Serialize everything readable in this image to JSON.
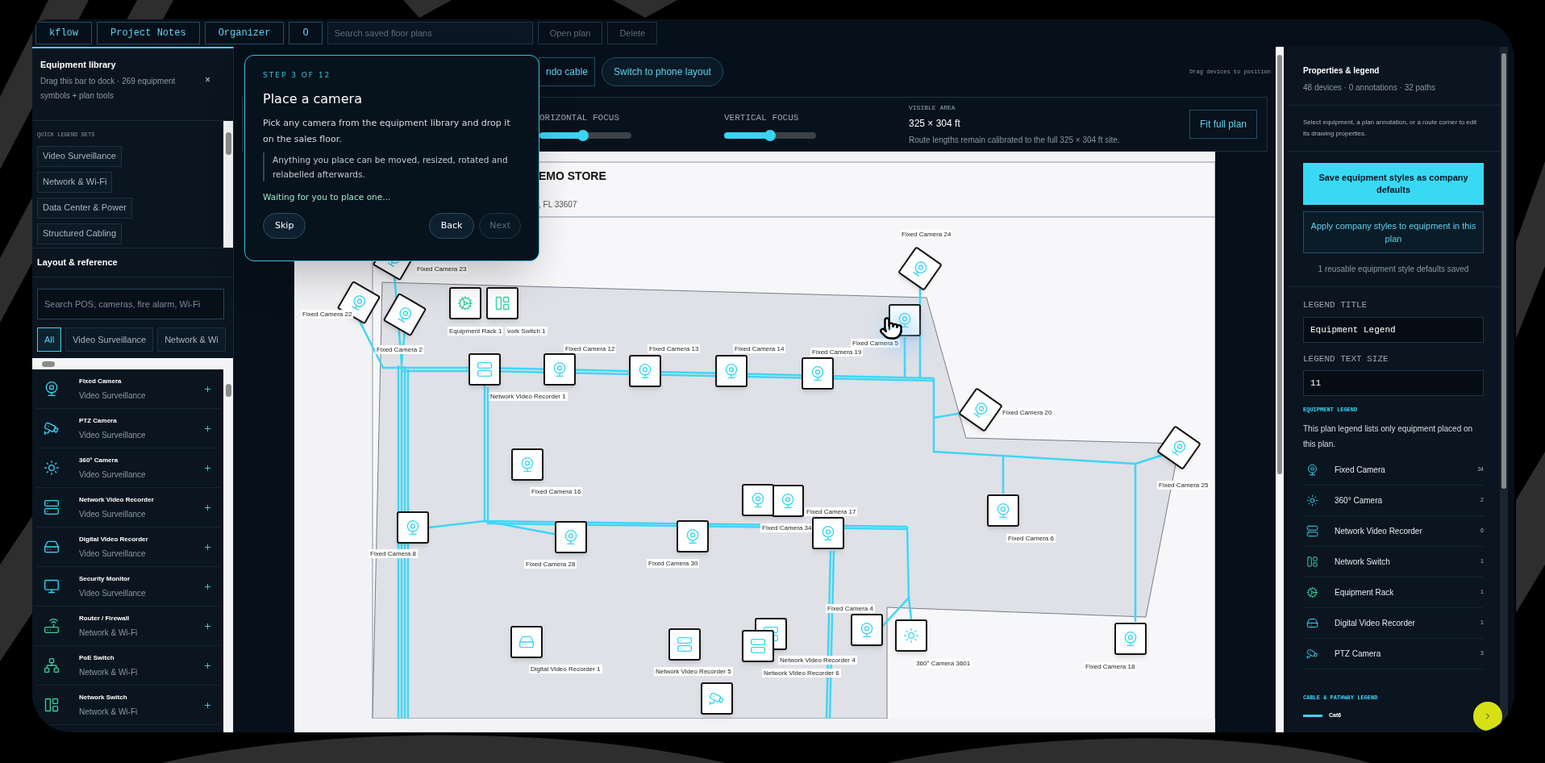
{
  "toolbar": {
    "buttons": [
      "kflow",
      "Project Notes",
      "Organizer",
      "O"
    ],
    "search": {
      "placeholder": "Search saved floor plans"
    },
    "actions": [
      "Open plan",
      "Delete"
    ]
  },
  "equipment_library": {
    "title": "Equipment library",
    "subtitle": "Drag this bar to dock · 269 equipment symbols + plan tools",
    "close": "×",
    "quick_legend_heading": "QUICK LEGEND SETS",
    "quick_legend_sets": [
      "Video Surveillance",
      "Network & Wi-Fi",
      "Data Center & Power",
      "Structured Cabling"
    ]
  },
  "layout_reference": {
    "title": "Layout & reference",
    "search": {
      "placeholder": "Search POS, cameras, fire alarm, Wi-Fi"
    },
    "filters": [
      {
        "label": "All",
        "selected": true
      },
      {
        "label": "Video Surveillance",
        "selected": false
      },
      {
        "label": "Network & Wi",
        "selected": false
      }
    ],
    "items": [
      {
        "name": "Fixed Camera",
        "category": "Video Surveillance",
        "kind": "fixed"
      },
      {
        "name": "PTZ Camera",
        "category": "Video Surveillance",
        "kind": "ptz"
      },
      {
        "name": "360° Camera",
        "category": "Video Surveillance",
        "kind": "cam360"
      },
      {
        "name": "Network Video Recorder",
        "category": "Video Surveillance",
        "kind": "nvr"
      },
      {
        "name": "Digital Video Recorder",
        "category": "Video Surveillance",
        "kind": "dvr"
      },
      {
        "name": "Security Monitor",
        "category": "Video Surveillance",
        "kind": "monitor"
      },
      {
        "name": "Router / Firewall",
        "category": "Network & Wi-Fi",
        "kind": "router"
      },
      {
        "name": "PoE Switch",
        "category": "Network & Wi-Fi",
        "kind": "poe"
      },
      {
        "name": "Network Switch",
        "category": "Network & Wi-Fi",
        "kind": "switch"
      }
    ]
  },
  "tour": {
    "step": "STEP 3 OF 12",
    "title": "Place a camera",
    "body": "Pick any camera from the equipment library and drop it on the sales floor.",
    "note": "Anything you place can be moved, resized, rotated and relabelled afterwards.",
    "status": "Waiting for you to place one...",
    "buttons": [
      {
        "label": "Skip",
        "disabled": false
      },
      {
        "label": "Back",
        "disabled": false
      },
      {
        "label": "Next",
        "disabled": true
      }
    ]
  },
  "canvas_toolbar": {
    "buttons": [
      "ndo cable",
      "Switch to phone layout"
    ],
    "hint": "Drag devices to position"
  },
  "focus": {
    "sliders": [
      {
        "label": "ORIZONTAL FOCUS",
        "level": 0.47
      },
      {
        "label": "VERTICAL FOCUS",
        "level": 0.5
      }
    ],
    "visible_area": {
      "label": "VISIBLE AREA",
      "value": "325 × 304 ft",
      "note": "Route lengths remain calibrated to the full 325 × 304 ft site."
    },
    "button": "Fit full plan"
  },
  "plan": {
    "title": "EMO STORE",
    "address": ", FL 33607",
    "devices": [
      {
        "label": "Fixed Camera 23",
        "kind": "fixed"
      },
      {
        "label": "Fixed Camera 22",
        "kind": "fixed"
      },
      {
        "label": "Fixed Camera 2",
        "kind": "fixed"
      },
      {
        "label": "Equipment Rack 1",
        "kind": "rack"
      },
      {
        "label": "vork Switch 1",
        "kind": "switch"
      },
      {
        "label": "Network Video Recorder 1",
        "kind": "nvr"
      },
      {
        "label": "Fixed Camera 12",
        "kind": "fixed"
      },
      {
        "label": "Fixed Camera 13",
        "kind": "fixed"
      },
      {
        "label": "Fixed Camera 14",
        "kind": "fixed"
      },
      {
        "label": "Fixed Camera 19",
        "kind": "fixed"
      },
      {
        "label": "Fixed Camera 5",
        "kind": "fixed"
      },
      {
        "label": "Fixed Camera 24",
        "kind": "fixed"
      },
      {
        "label": "Fixed Camera 20",
        "kind": "fixed"
      },
      {
        "label": "Fixed Camera 25",
        "kind": "fixed"
      },
      {
        "label": "Fixed Camera 16",
        "kind": "fixed"
      },
      {
        "label": "Fixed Camera 8",
        "kind": "fixed"
      },
      {
        "label": "Fixed Camera 28",
        "kind": "fixed"
      },
      {
        "label": "Fixed Camera 30",
        "kind": "fixed"
      },
      {
        "label": "Fixed Camera 17",
        "kind": "fixed"
      },
      {
        "label": "Fixed Camera 34",
        "kind": "fixed"
      },
      {
        "kind": "fixed"
      },
      {
        "label": "Fixed Camera 6",
        "kind": "fixed"
      },
      {
        "label": "Fixed Camera 4",
        "kind": "fixed"
      },
      {
        "label": "360° Camera 3601",
        "kind": "cam360"
      },
      {
        "label": "Fixed Camera 18",
        "kind": "fixed"
      },
      {
        "label": "Digital Video Recorder 1",
        "kind": "dvr"
      },
      {
        "label": "Network Video Recorder 5",
        "kind": "nvr"
      },
      {
        "label": "Network Video Recorder 4",
        "kind": "nvr"
      },
      {
        "label": "Network Video Recorder 6",
        "kind": "nvr"
      },
      {
        "kind": "ptz"
      }
    ]
  },
  "properties": {
    "title": "Properties & legend",
    "summary": "48 devices · 0 annotations · 32 paths",
    "hint": "Select equipment, a plan annotation, or a route corner to edit its drawing properties.",
    "save_button": "Save equipment styles as company defaults",
    "apply_button": "Apply company styles to equipment in this plan",
    "saved_note": "1 reusable equipment style defaults saved",
    "fields": [
      {
        "label": "LEGEND TITLE",
        "value": "Equipment Legend"
      },
      {
        "label": "LEGEND TEXT SIZE",
        "value": "11"
      }
    ],
    "equipment_legend": {
      "heading": "EQUIPMENT LEGEND",
      "description": "This plan legend lists only equipment placed on this plan.",
      "rows": [
        {
          "name": "Fixed Camera",
          "count": "34",
          "kind": "fixed"
        },
        {
          "name": "360° Camera",
          "count": "2",
          "kind": "cam360"
        },
        {
          "name": "Network Video Recorder",
          "count": "6",
          "kind": "nvr"
        },
        {
          "name": "Network Switch",
          "count": "1",
          "kind": "switch"
        },
        {
          "name": "Equipment Rack",
          "count": "1",
          "kind": "rack"
        },
        {
          "name": "Digital Video Recorder",
          "count": "1",
          "kind": "dvr"
        },
        {
          "name": "PTZ Camera",
          "count": "3",
          "kind": "ptz"
        }
      ]
    },
    "cable_legend": {
      "heading": "CABLE & PATHWAY LEGEND",
      "rows": [
        {
          "name": "Cat6",
          "color": "#38d5f2"
        }
      ]
    }
  }
}
